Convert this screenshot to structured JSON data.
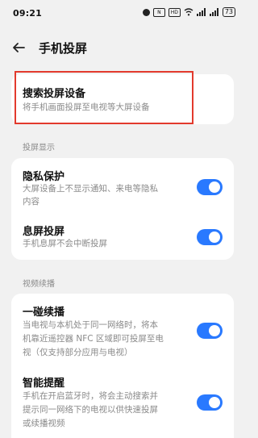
{
  "status": {
    "time": "09:21",
    "icons": [
      "alarm-icon",
      "nfc-icon",
      "hd-icon",
      "wifi-icon",
      "signal-5g-icon",
      "signal-icon"
    ],
    "battery": "73"
  },
  "header": {
    "back_icon": "arrow-left-icon",
    "title": "手机投屏"
  },
  "search": {
    "title": "搜索投屏设备",
    "desc": "将手机画面投屏至电视等大屏设备"
  },
  "section_display": {
    "label": "投屏显示",
    "items": [
      {
        "title": "隐私保护",
        "desc_line1": "大屏设备上不显示通知、来电等隐私",
        "desc_line2": "内容",
        "enabled": true
      },
      {
        "title": "息屏投屏",
        "desc_line1": "手机息屏不会中断投屏",
        "enabled": true
      }
    ]
  },
  "section_continue": {
    "label": "视频续播",
    "items": [
      {
        "title": "一碰续播",
        "desc_line1": "当电视与本机处于同一网络时，将本",
        "desc_line2": "机靠近遥控器 NFC 区域即可投屏至电",
        "desc_line3": "视（仅支持部分应用与电视）",
        "enabled": true
      },
      {
        "title": "智能提醒",
        "desc_line1": "手机在开启蓝牙时，将会主动搜索并",
        "desc_line2": "提示同一网络下的电视以供快速投屏",
        "desc_line3": "或续播视频",
        "enabled": true
      }
    ]
  },
  "colors": {
    "accent": "#2979ff",
    "highlight": "#e23a2d",
    "background": "#f1f1f1"
  }
}
